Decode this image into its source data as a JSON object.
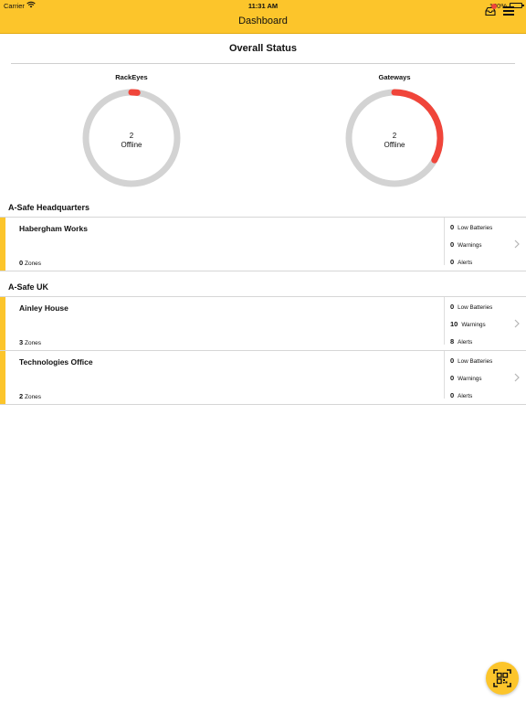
{
  "status_bar": {
    "carrier": "Carrier",
    "time": "11:31 AM",
    "battery": "100%"
  },
  "nav": {
    "title": "Dashboard",
    "icons": [
      "inbox-icon",
      "menu-icon"
    ],
    "inbox_badge_color": "#f0453a"
  },
  "overall": {
    "title": "Overall Status",
    "gauges": [
      {
        "label": "RackEyes",
        "count": "2",
        "state": "Offline",
        "fraction_offline": 0.02
      },
      {
        "label": "Gateways",
        "count": "2",
        "state": "Offline",
        "fraction_offline": 0.33
      }
    ]
  },
  "groups": [
    {
      "title": "A-Safe Headquarters",
      "sites": [
        {
          "name": "Habergham Works",
          "zones_count": "0",
          "zones_label": "Zones",
          "low_batteries": "0",
          "warnings": "0",
          "alerts": "0"
        }
      ]
    },
    {
      "title": "A-Safe UK",
      "sites": [
        {
          "name": "Ainley House",
          "zones_count": "3",
          "zones_label": "Zones",
          "low_batteries": "0",
          "warnings": "10",
          "alerts": "8"
        },
        {
          "name": "Technologies Office",
          "zones_count": "2",
          "zones_label": "Zones",
          "low_batteries": "0",
          "warnings": "0",
          "alerts": "0"
        }
      ]
    }
  ],
  "stat_labels": {
    "low_batteries": "Low Batteries",
    "warnings": "Warnings",
    "alerts": "Alerts"
  },
  "colors": {
    "accent": "#fcc52b",
    "offline": "#f0453a",
    "track": "#d3d3d3"
  },
  "fab": {
    "icon": "qr-scan-icon"
  }
}
